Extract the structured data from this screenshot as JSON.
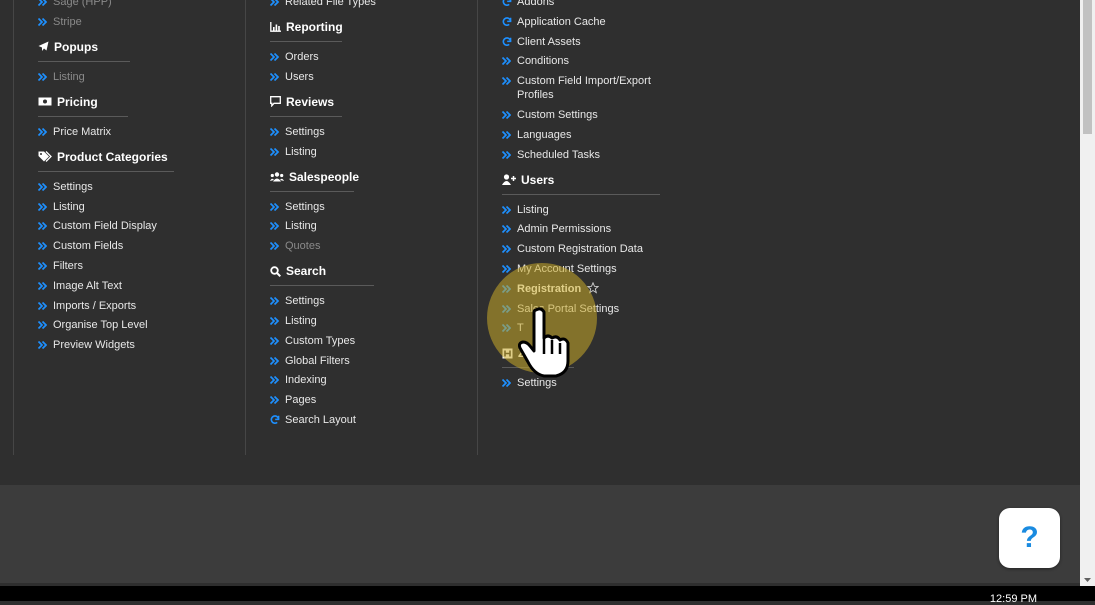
{
  "colors": {
    "accent": "#1e90ff",
    "link": "#e8e8e8",
    "muted": "#8a8a8a",
    "highlight": "#c9a92a"
  },
  "col1": {
    "top_items": [
      {
        "label": "Sage (HPP)",
        "muted": true
      },
      {
        "label": "Stripe",
        "muted": true
      }
    ],
    "sections": [
      {
        "title": "Popups",
        "icon": "paper-plane-icon",
        "items": [
          {
            "label": "Listing",
            "muted": true
          }
        ]
      },
      {
        "title": "Pricing",
        "icon": "money-bill-icon",
        "items": [
          {
            "label": "Price Matrix"
          }
        ]
      },
      {
        "title": "Product Categories",
        "icon": "tags-icon",
        "items": [
          {
            "label": "Settings"
          },
          {
            "label": "Listing"
          },
          {
            "label": "Custom Field Display"
          },
          {
            "label": "Custom Fields"
          },
          {
            "label": "Filters"
          },
          {
            "label": "Image Alt Text"
          },
          {
            "label": "Imports / Exports"
          },
          {
            "label": "Organise Top Level"
          },
          {
            "label": "Preview Widgets"
          }
        ]
      }
    ]
  },
  "col2": {
    "top_items": [
      {
        "label": "Related File Types"
      }
    ],
    "sections": [
      {
        "title": "Reporting",
        "icon": "chart-icon",
        "items": [
          {
            "label": "Orders"
          },
          {
            "label": "Users"
          }
        ]
      },
      {
        "title": "Reviews",
        "icon": "comment-icon",
        "items": [
          {
            "label": "Settings"
          },
          {
            "label": "Listing"
          }
        ]
      },
      {
        "title": "Salespeople",
        "icon": "users-icon",
        "items": [
          {
            "label": "Settings"
          },
          {
            "label": "Listing"
          },
          {
            "label": "Quotes",
            "muted": true
          }
        ]
      },
      {
        "title": "Search",
        "icon": "search-icon",
        "items": [
          {
            "label": "Settings"
          },
          {
            "label": "Listing"
          },
          {
            "label": "Custom Types"
          },
          {
            "label": "Global Filters"
          },
          {
            "label": "Indexing"
          },
          {
            "label": "Pages"
          },
          {
            "label": "Search Layout",
            "icon": "sync"
          }
        ]
      }
    ]
  },
  "col3": {
    "top_items": [
      {
        "label": "Addons",
        "icon": "sync"
      },
      {
        "label": "Application Cache",
        "icon": "sync"
      },
      {
        "label": "Client Assets",
        "icon": "sync"
      },
      {
        "label": "Conditions"
      },
      {
        "label": "Custom Field Import/Export Profiles"
      },
      {
        "label": "Custom Settings"
      },
      {
        "label": "Languages"
      },
      {
        "label": "Scheduled Tasks"
      }
    ],
    "sections": [
      {
        "title": "Users",
        "icon": "user-plus-icon",
        "items": [
          {
            "label": "Listing"
          },
          {
            "label": "Admin Permissions"
          },
          {
            "label": "Custom Registration Data"
          },
          {
            "label": "My Account Settings"
          },
          {
            "label": "Registration",
            "highlight": true,
            "star": true
          },
          {
            "label": "Sales Portal Settings"
          },
          {
            "label": "T"
          }
        ]
      },
      {
        "title": "Zoho",
        "icon": "zoho-icon",
        "items": [
          {
            "label": "Settings"
          }
        ]
      }
    ]
  },
  "help_button": {
    "label": "?"
  },
  "clock": {
    "time": "12:59 PM"
  }
}
